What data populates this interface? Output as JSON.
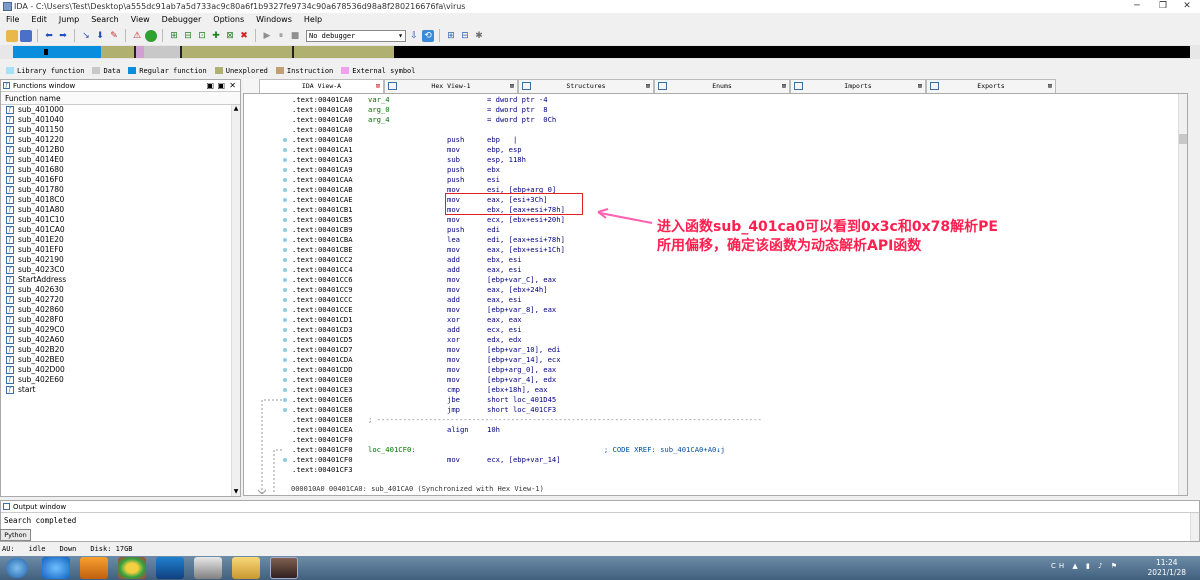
{
  "window": {
    "title": "IDA - C:\\Users\\Test\\Desktop\\a555dc91ab7a5d733ac9c80a6f1b9327fe9734c90a678536d98a8f280216676fa\\virus"
  },
  "menu": [
    "File",
    "Edit",
    "Jump",
    "Search",
    "View",
    "Debugger",
    "Options",
    "Windows",
    "Help"
  ],
  "toolbar": {
    "debugger_select": "No debugger"
  },
  "legend": [
    {
      "label": "Library function",
      "color": "#a8e0f8"
    },
    {
      "label": "Data",
      "color": "#c8c8c8"
    },
    {
      "label": "Regular function",
      "color": "#0a8ddc"
    },
    {
      "label": "Unexplored",
      "color": "#b0b070"
    },
    {
      "label": "Instruction",
      "color": "#c0a070"
    },
    {
      "label": "External symbol",
      "color": "#f0a0f0"
    }
  ],
  "functions_window": {
    "title": "Functions window",
    "header": "Function name",
    "items": [
      "sub_401000",
      "sub_401040",
      "sub_401150",
      "sub_401220",
      "sub_4012B0",
      "sub_4014E0",
      "sub_401680",
      "sub_4016F0",
      "sub_401780",
      "sub_4018C0",
      "sub_401A80",
      "sub_401C10",
      "sub_401CA0",
      "sub_401E20",
      "sub_401EF0",
      "sub_402190",
      "sub_4023C0",
      "StartAddress",
      "sub_402630",
      "sub_402720",
      "sub_402860",
      "sub_4028F0",
      "sub_4029C0",
      "sub_402A60",
      "sub_402B20",
      "sub_402BE0",
      "sub_402D00",
      "sub_402E60",
      "start"
    ]
  },
  "tabs": [
    {
      "label": "IDA View-A",
      "active": true,
      "close": "⊠"
    },
    {
      "label": "Hex View-1",
      "close": "⊠"
    },
    {
      "label": "Structures",
      "close": "⊠"
    },
    {
      "label": "Enums",
      "close": "⊠"
    },
    {
      "label": "Imports",
      "close": "⊠"
    },
    {
      "label": "Exports",
      "close": "⊠"
    }
  ],
  "code": [
    {
      "addr": ".text:00401CA0",
      "label": "var_4",
      "mn": "",
      "op": "= dword ptr -4"
    },
    {
      "addr": ".text:00401CA0",
      "label": "arg_0",
      "mn": "",
      "op": "= dword ptr  8"
    },
    {
      "addr": ".text:00401CA0",
      "label": "arg_4",
      "mn": "",
      "op": "= dword ptr  0Ch"
    },
    {
      "addr": ".text:00401CA0",
      "label": "",
      "mn": "",
      "op": ""
    },
    {
      "addr": ".text:00401CA0",
      "label": "",
      "mn": "push",
      "op": "ebp   |"
    },
    {
      "addr": ".text:00401CA1",
      "label": "",
      "mn": "mov",
      "op": "ebp, esp"
    },
    {
      "addr": ".text:00401CA3",
      "label": "",
      "mn": "sub",
      "op": "esp, 118h"
    },
    {
      "addr": ".text:00401CA9",
      "label": "",
      "mn": "push",
      "op": "ebx"
    },
    {
      "addr": ".text:00401CAA",
      "label": "",
      "mn": "push",
      "op": "esi"
    },
    {
      "addr": ".text:00401CAB",
      "label": "",
      "mn": "mov",
      "op": "esi, [ebp+arg_0]"
    },
    {
      "addr": ".text:00401CAE",
      "label": "",
      "mn": "mov",
      "op": "eax, [esi+3Ch]"
    },
    {
      "addr": ".text:00401CB1",
      "label": "",
      "mn": "mov",
      "op": "ebx, [eax+esi+78h]"
    },
    {
      "addr": ".text:00401CB5",
      "label": "",
      "mn": "mov",
      "op": "ecx, [ebx+esi+20h]"
    },
    {
      "addr": ".text:00401CB9",
      "label": "",
      "mn": "push",
      "op": "edi"
    },
    {
      "addr": ".text:00401CBA",
      "label": "",
      "mn": "lea",
      "op": "edi, [eax+esi+78h]"
    },
    {
      "addr": ".text:00401CBE",
      "label": "",
      "mn": "mov",
      "op": "eax, [ebx+esi+1Ch]"
    },
    {
      "addr": ".text:00401CC2",
      "label": "",
      "mn": "add",
      "op": "ebx, esi"
    },
    {
      "addr": ".text:00401CC4",
      "label": "",
      "mn": "add",
      "op": "eax, esi"
    },
    {
      "addr": ".text:00401CC6",
      "label": "",
      "mn": "mov",
      "op": "[ebp+var_C], eax"
    },
    {
      "addr": ".text:00401CC9",
      "label": "",
      "mn": "mov",
      "op": "eax, [ebx+24h]"
    },
    {
      "addr": ".text:00401CCC",
      "label": "",
      "mn": "add",
      "op": "eax, esi"
    },
    {
      "addr": ".text:00401CCE",
      "label": "",
      "mn": "mov",
      "op": "[ebp+var_8], eax"
    },
    {
      "addr": ".text:00401CD1",
      "label": "",
      "mn": "xor",
      "op": "eax, eax"
    },
    {
      "addr": ".text:00401CD3",
      "label": "",
      "mn": "add",
      "op": "ecx, esi"
    },
    {
      "addr": ".text:00401CD5",
      "label": "",
      "mn": "xor",
      "op": "edx, edx"
    },
    {
      "addr": ".text:00401CD7",
      "label": "",
      "mn": "mov",
      "op": "[ebp+var_10], edi"
    },
    {
      "addr": ".text:00401CDA",
      "label": "",
      "mn": "mov",
      "op": "[ebp+var_14], ecx"
    },
    {
      "addr": ".text:00401CDD",
      "label": "",
      "mn": "mov",
      "op": "[ebp+arg_0], eax"
    },
    {
      "addr": ".text:00401CE0",
      "label": "",
      "mn": "mov",
      "op": "[ebp+var_4], edx"
    },
    {
      "addr": ".text:00401CE3",
      "label": "",
      "mn": "cmp",
      "op": "[ebx+18h], eax"
    },
    {
      "addr": ".text:00401CE6",
      "label": "",
      "mn": "jbe",
      "op": "short loc_401D45"
    },
    {
      "addr": ".text:00401CE8",
      "label": "",
      "mn": "jmp",
      "op": "short loc_401CF3"
    },
    {
      "addr": ".text:00401CE8",
      "label": "; -----------------------------------------------------------------------------------------",
      "mn": "",
      "op": "",
      "sep": true
    },
    {
      "addr": ".text:00401CEA",
      "label": "",
      "mn": "align",
      "op": "10h",
      "grey": true
    },
    {
      "addr": ".text:00401CF0",
      "label": "",
      "mn": "",
      "op": ""
    },
    {
      "addr": ".text:00401CF0",
      "label": "loc_401CF0:",
      "mn": "",
      "op": "                           ; CODE XREF: sub_401CA0+A0↓j"
    },
    {
      "addr": ".text:00401CF0",
      "label": "",
      "mn": "mov",
      "op": "ecx, [ebp+var_14]"
    },
    {
      "addr": ".text:00401CF3",
      "label": "",
      "mn": "",
      "op": ""
    }
  ],
  "status_line": "000010A0 00401CA0: sub_401CA0 (Synchronized with Hex View-1)",
  "annotation": {
    "line1": "进入函数sub_401ca0可以看到0x3c和0x78解析PE",
    "line2": "所用偏移，确定该函数为动态解析API函数"
  },
  "output_window": {
    "title": "Output window",
    "text": "Search completed",
    "button": "Python"
  },
  "ida_status": {
    "au": "AU:",
    "state": "idle",
    "dir": "Down",
    "disk": "Disk: 17GB"
  },
  "clock": {
    "time": "11:24",
    "date": "2021/1/28"
  },
  "tray": "CH"
}
